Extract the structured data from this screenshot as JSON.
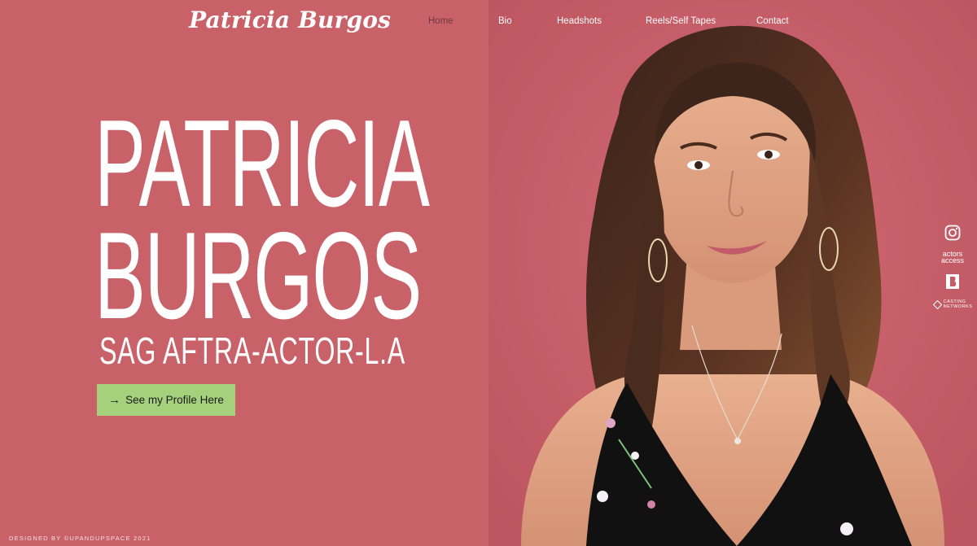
{
  "site": {
    "logo": "Patricia Burgos"
  },
  "nav": {
    "items": [
      {
        "label": "Home",
        "active": true
      },
      {
        "label": "Bio",
        "active": false
      },
      {
        "label": "Headshots",
        "active": false
      },
      {
        "label": "Reels/Self Tapes",
        "active": false
      },
      {
        "label": "Contact",
        "active": false
      }
    ]
  },
  "hero": {
    "name_line1": "PATRICIA",
    "name_line2": "BURGOS",
    "subtitle": "SAG AFTRA-ACTOR-L.A",
    "cta_label": "See my Profile Here",
    "cta_icon": "arrow-right-icon"
  },
  "social": {
    "items": [
      {
        "icon": "instagram-icon"
      },
      {
        "icon": "actors-access-icon",
        "label_line1": "actors",
        "label_line2": "access"
      },
      {
        "icon": "backstage-icon"
      },
      {
        "icon": "casting-networks-icon",
        "label_line1": "CASTING",
        "label_line2": "NETWORKS"
      }
    ]
  },
  "footer": {
    "credit": "DESIGNED BY ©UPANDUPSPACE 2021"
  },
  "colors": {
    "background": "#c96169",
    "cta_background": "#a6d17c",
    "active_nav": "#6e3b40"
  }
}
